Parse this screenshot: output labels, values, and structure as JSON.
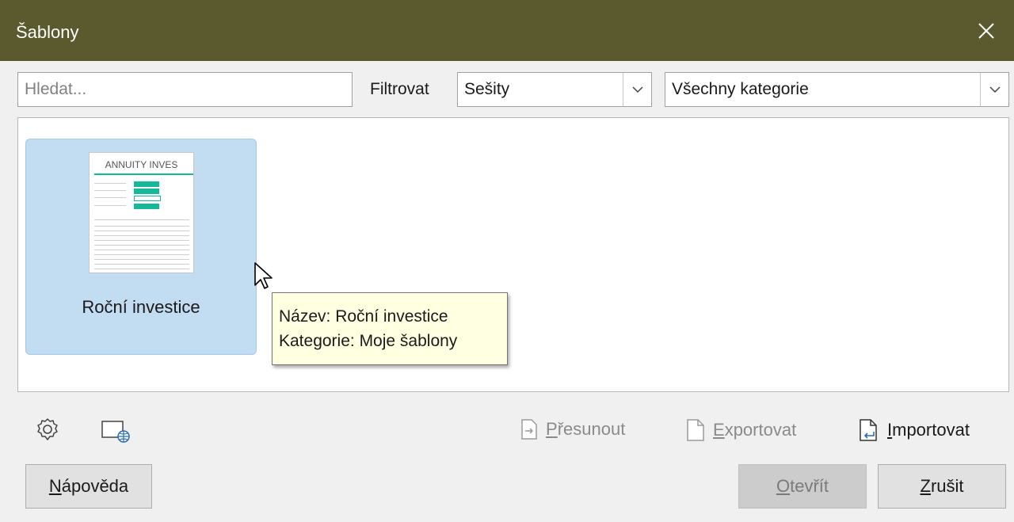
{
  "window": {
    "title": "Šablony"
  },
  "search": {
    "placeholder": "Hledat..."
  },
  "filter": {
    "label": "Filtrovat",
    "type_value": "Sešity",
    "category_value": "Všechny kategorie"
  },
  "templates": [
    {
      "name": "Roční investice",
      "thumbnail_title": "ANNUITY INVES",
      "selected": true
    }
  ],
  "tooltip": {
    "name_line": "Název: Roční investice",
    "category_line": "Kategorie: Moje šablony"
  },
  "actions": {
    "move": "Přesunout",
    "export": "Exportovat",
    "import": "Importovat"
  },
  "buttons": {
    "help": "Nápověda",
    "open": "Otevřít",
    "cancel": "Zrušit"
  },
  "colors": {
    "titlebar": "#5a5a2e",
    "selection": "#c2dcf2",
    "tooltip_bg": "#ffffe1",
    "thumbnail_accent": "#17b89a"
  },
  "icons": {
    "settings": "gear-icon",
    "online": "globe-window-icon",
    "move": "move-document-icon",
    "export": "export-document-icon",
    "import": "import-document-icon"
  }
}
